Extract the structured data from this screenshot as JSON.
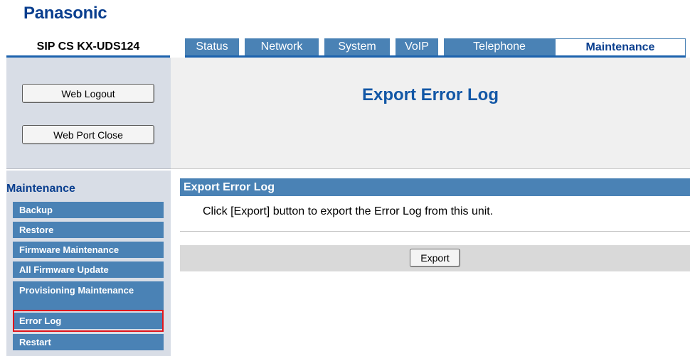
{
  "brand": {
    "logo": "Panasonic"
  },
  "model": "SIP CS KX-UDS124",
  "tabs": [
    {
      "label": "Status"
    },
    {
      "label": "Network"
    },
    {
      "label": "System"
    },
    {
      "label": "VoIP"
    },
    {
      "label": "Telephone"
    },
    {
      "label": "Maintenance",
      "active": true
    }
  ],
  "sidebar": {
    "web_logout": "Web Logout",
    "web_port_close": "Web Port Close",
    "section_title": "Maintenance",
    "items": [
      {
        "label": "Backup"
      },
      {
        "label": "Restore"
      },
      {
        "label": "Firmware Maintenance"
      },
      {
        "label": "All Firmware Update"
      },
      {
        "label": "Provisioning Maintenance"
      },
      {
        "label": "Error Log",
        "selected": true
      },
      {
        "label": "Restart"
      }
    ]
  },
  "main": {
    "page_title": "Export Error Log",
    "section_title": "Export Error Log",
    "instruction": "Click [Export] button to export the Error Log from this unit.",
    "export_button": "Export"
  },
  "colors": {
    "brand_blue": "#0a3f8f",
    "tab_bg": "#4a82b5",
    "sidebar_bg": "#d8dde6",
    "highlight": "#e0151c"
  }
}
